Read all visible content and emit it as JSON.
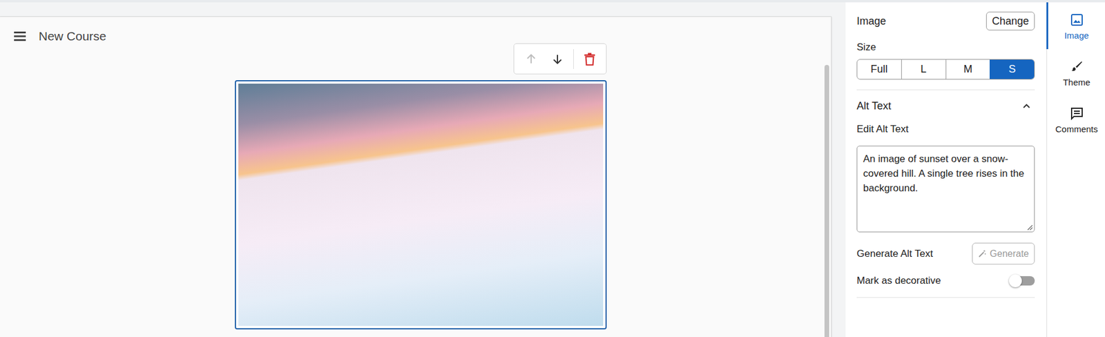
{
  "header": {
    "title": "New Course"
  },
  "toolbar": {
    "move_up": {
      "disabled": true
    },
    "move_down": {
      "disabled": false
    }
  },
  "image_block": {
    "selected": true
  },
  "panel": {
    "title": "Image",
    "change_button": "Change",
    "size_label": "Size",
    "sizes": [
      {
        "label": "Full",
        "selected": false
      },
      {
        "label": "L",
        "selected": false
      },
      {
        "label": "M",
        "selected": false
      },
      {
        "label": "S",
        "selected": true
      }
    ],
    "alt_text": {
      "title": "Alt Text",
      "expanded": true,
      "edit_label": "Edit Alt Text",
      "value": "An image of sunset over a snow-covered hill. A single tree rises in the background.",
      "generate_label": "Generate Alt Text",
      "generate_button": "Generate",
      "generate_disabled": true
    },
    "decorative": {
      "label": "Mark as decorative",
      "on": false
    }
  },
  "rail": [
    {
      "label": "Image",
      "selected": true
    },
    {
      "label": "Theme",
      "selected": false
    },
    {
      "label": "Comments",
      "selected": false
    }
  ]
}
